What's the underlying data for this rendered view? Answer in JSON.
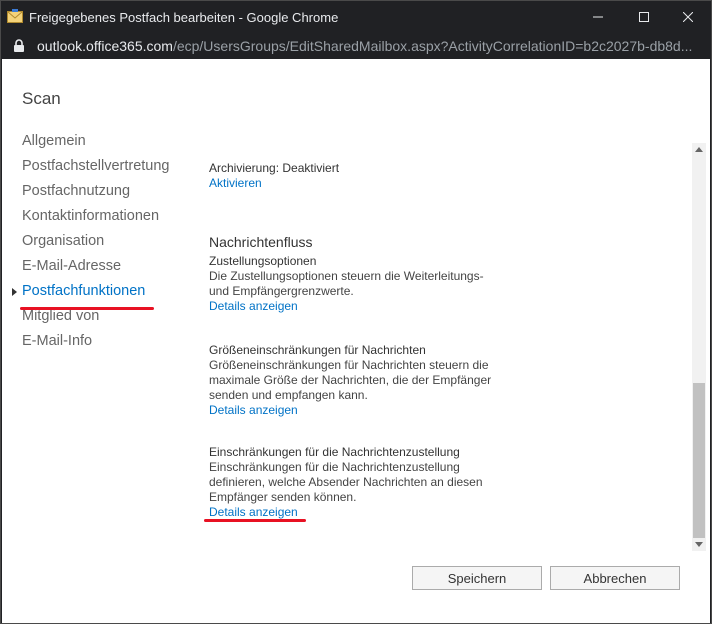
{
  "window": {
    "title": "Freigegebenes Postfach bearbeiten - Google Chrome"
  },
  "address": {
    "host": "outlook.office365.com",
    "path": "/ecp/UsersGroups/EditSharedMailbox.aspx?ActivityCorrelationID=b2c2027b-db8d..."
  },
  "page": {
    "title": "Scan"
  },
  "nav": {
    "items": [
      {
        "label": "Allgemein"
      },
      {
        "label": "Postfachstellvertretung"
      },
      {
        "label": "Postfachnutzung"
      },
      {
        "label": "Kontaktinformationen"
      },
      {
        "label": "Organisation"
      },
      {
        "label": "E-Mail-Adresse"
      },
      {
        "label": "Postfachfunktionen"
      },
      {
        "label": "Mitglied von"
      },
      {
        "label": "E-Mail-Info"
      }
    ],
    "active_index": 6
  },
  "archiving": {
    "status": "Archivierung: Deaktiviert",
    "action": "Aktivieren"
  },
  "mailflow": {
    "heading": "Nachrichtenfluss",
    "delivery": {
      "title": "Zustellungsoptionen",
      "desc_line1": "Die Zustellungsoptionen steuern die Weiterleitungs-",
      "desc_line2": "und Empfängergrenzwerte.",
      "link": "Details anzeigen"
    },
    "size": {
      "title": "Größeneinschränkungen für Nachrichten",
      "desc_line1": "Größeneinschränkungen für Nachrichten steuern die",
      "desc_line2": "maximale Größe der Nachrichten, die der Empfänger",
      "desc_line3": "senden und empfangen kann.",
      "link": "Details anzeigen"
    },
    "restrictions": {
      "title": "Einschränkungen für die Nachrichtenzustellung",
      "desc_line1": "Einschränkungen für die Nachrichtenzustellung",
      "desc_line2": "definieren, welche Absender Nachrichten an diesen",
      "desc_line3": "Empfänger senden können.",
      "link": "Details anzeigen"
    }
  },
  "buttons": {
    "save": "Speichern",
    "cancel": "Abbrechen"
  },
  "colors": {
    "link": "#0072c6",
    "highlight": "#e81123",
    "chrome_bar": "#202124"
  }
}
